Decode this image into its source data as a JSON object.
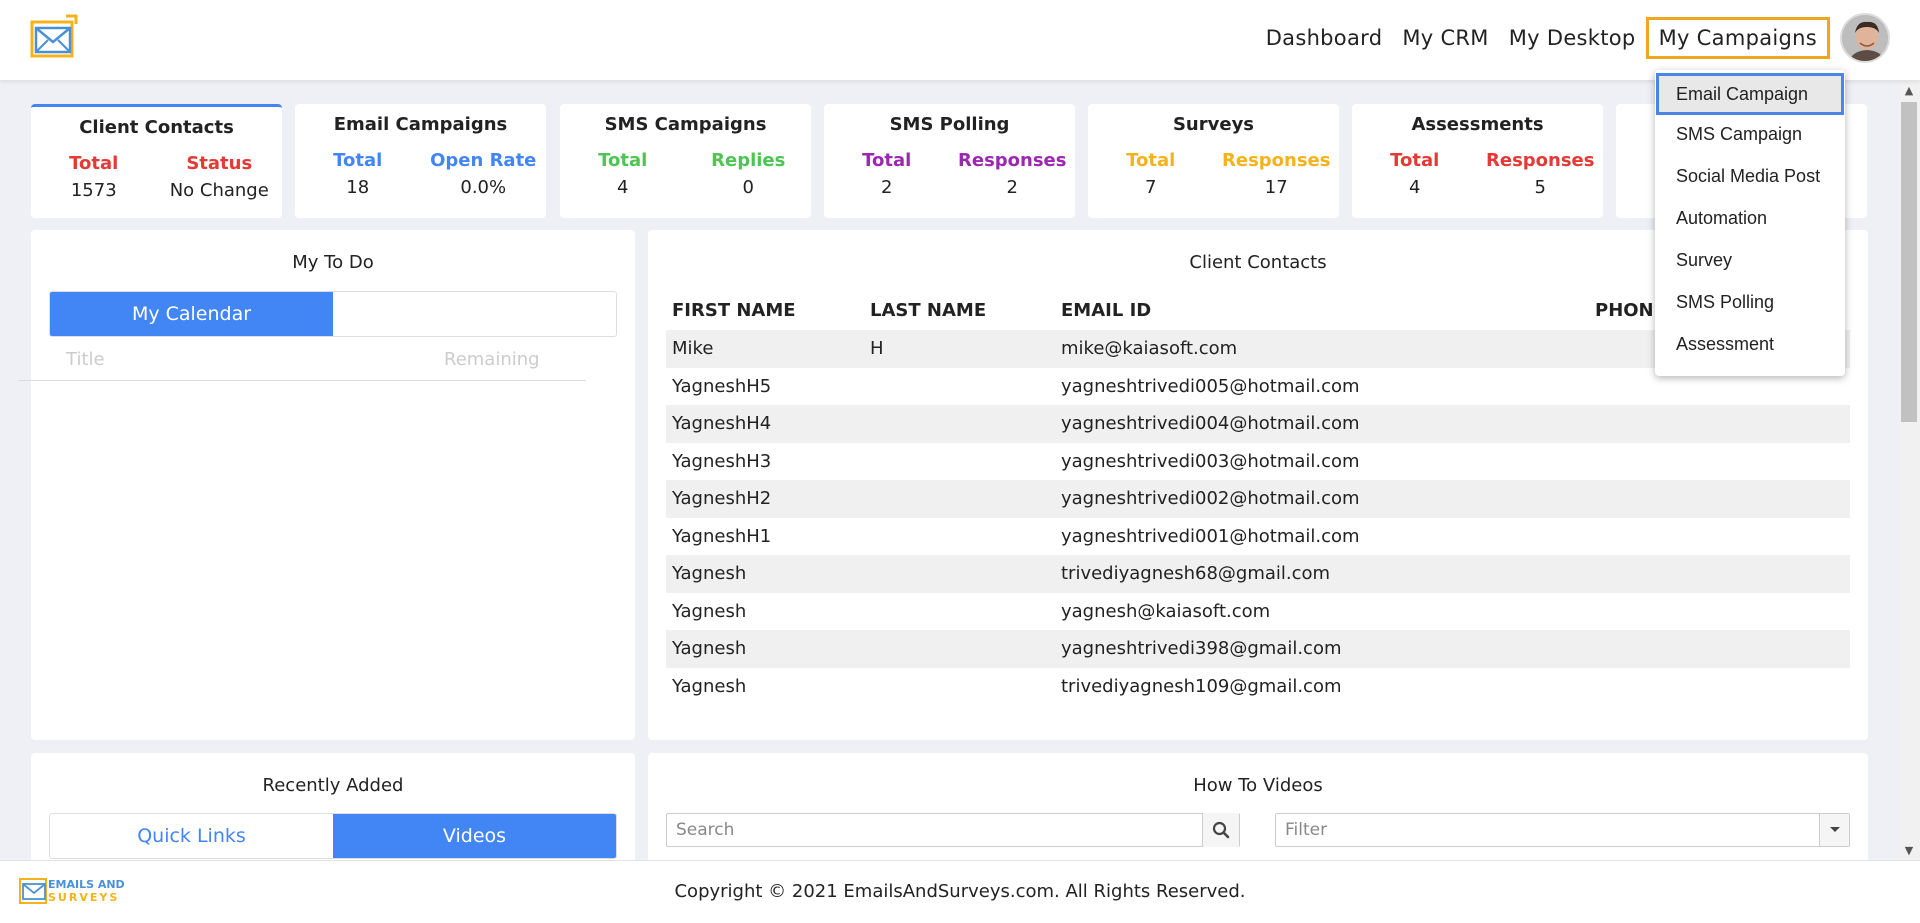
{
  "nav": {
    "items": [
      "Dashboard",
      "My CRM",
      "My Desktop",
      "My Campaigns"
    ]
  },
  "stats": [
    {
      "title": "Client Contacts",
      "left_label": "Total",
      "left_value": "1573",
      "right_label": "Status",
      "right_value": "No Change",
      "left_color": "#e53935",
      "right_color": "#e53935"
    },
    {
      "title": "Email Campaigns",
      "left_label": "Total",
      "left_value": "18",
      "right_label": "Open Rate",
      "right_value": "0.0%",
      "left_color": "#4285f4",
      "right_color": "#4285f4"
    },
    {
      "title": "SMS Campaigns",
      "left_label": "Total",
      "left_value": "4",
      "right_label": "Replies",
      "right_value": "0",
      "left_color": "#4cc552",
      "right_color": "#4cc552"
    },
    {
      "title": "SMS Polling",
      "left_label": "Total",
      "left_value": "2",
      "right_label": "Responses",
      "right_value": "2",
      "left_color": "#9c27b0",
      "right_color": "#9c27b0"
    },
    {
      "title": "Surveys",
      "left_label": "Total",
      "left_value": "7",
      "right_label": "Responses",
      "right_value": "17",
      "left_color": "#f5b21b",
      "right_color": "#f5b21b"
    },
    {
      "title": "Assessments",
      "left_label": "Total",
      "left_value": "4",
      "right_label": "Responses",
      "right_value": "5",
      "left_color": "#e53935",
      "right_color": "#e53935"
    }
  ],
  "todo": {
    "title": "My To Do",
    "tab_calendar": "My Calendar",
    "col_title": "Title",
    "col_remaining": "Remaining"
  },
  "contacts": {
    "title": "Client Contacts",
    "headers": [
      "FIRST NAME",
      "LAST NAME",
      "EMAIL ID",
      "PHONE"
    ],
    "rows": [
      {
        "first": "Mike",
        "last": "H",
        "email": "mike@kaiasoft.com"
      },
      {
        "first": "YagneshH5",
        "last": "",
        "email": "yagneshtrivedi005@hotmail.com"
      },
      {
        "first": "YagneshH4",
        "last": "",
        "email": "yagneshtrivedi004@hotmail.com"
      },
      {
        "first": "YagneshH3",
        "last": "",
        "email": "yagneshtrivedi003@hotmail.com"
      },
      {
        "first": "YagneshH2",
        "last": "",
        "email": "yagneshtrivedi002@hotmail.com"
      },
      {
        "first": "YagneshH1",
        "last": "",
        "email": "yagneshtrivedi001@hotmail.com"
      },
      {
        "first": "Yagnesh",
        "last": "",
        "email": "trivediyagnesh68@gmail.com"
      },
      {
        "first": "Yagnesh",
        "last": "",
        "email": "yagnesh@kaiasoft.com"
      },
      {
        "first": "Yagnesh",
        "last": "",
        "email": "yagneshtrivedi398@gmail.com"
      },
      {
        "first": "Yagnesh",
        "last": "",
        "email": "trivediyagnesh109@gmail.com"
      }
    ]
  },
  "recent": {
    "title": "Recently Added",
    "tab_links": "Quick Links",
    "tab_videos": "Videos"
  },
  "videos": {
    "title": "How To Videos",
    "search_placeholder": "Search",
    "filter_placeholder": "Filter"
  },
  "dropdown": {
    "items": [
      "Email Campaign",
      "SMS Campaign",
      "Social Media Post",
      "Automation",
      "Survey",
      "SMS Polling",
      "Assessment"
    ]
  },
  "footer": {
    "copyright": "Copyright © 2021 EmailsAndSurveys.com. All Rights Reserved.",
    "logo_line1": "EMAILS AND",
    "logo_line2": "SURVEYS"
  },
  "colors": {
    "accent": "#4285f4",
    "active_border": "#f0a61f"
  }
}
